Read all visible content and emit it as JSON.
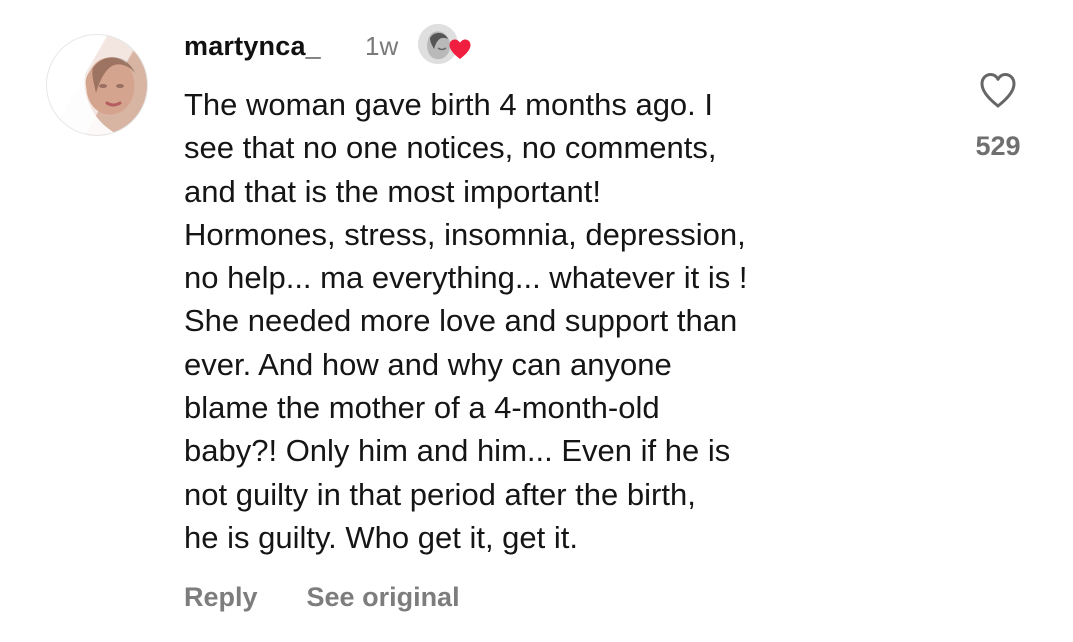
{
  "comment": {
    "username": "martynca_",
    "time": "1w",
    "text": "The woman gave birth 4 months ago. I\nsee that no one notices, no comments,\nand that is the most important!\nHormones, stress, insomnia, depression,\nno help... ma everything... whatever it is !\nShe needed more love and support than\never. And how and why can anyone\nblame the mother of a 4-month-old\nbaby?! Only him and him... Even if he is\nnot guilty in that period after the birth,\nhe is guilty. Who get it, get it.",
    "like_count": "529",
    "actions": {
      "reply": "Reply",
      "see_original": "See original"
    }
  },
  "icons": {
    "like": "heart-icon",
    "creator_like": "red-heart-icon"
  },
  "colors": {
    "text": "#151515",
    "muted": "#7a7a7a",
    "heart_red": "#f01f3f"
  }
}
